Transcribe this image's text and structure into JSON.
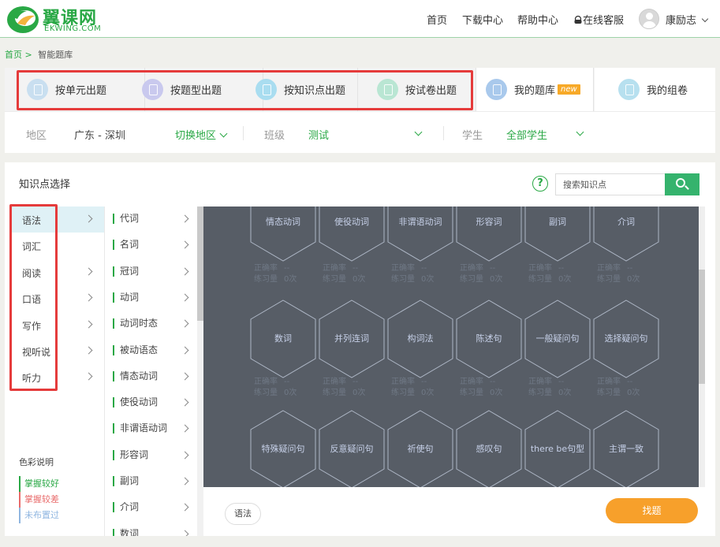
{
  "brand": {
    "name_cn": "翼课网",
    "name_en": "EKWING.COM",
    "color": "#29a845"
  },
  "nav": {
    "home": "首页",
    "download": "下载中心",
    "help": "帮助中心",
    "service": "在线客服",
    "user": "康励志"
  },
  "breadcrumb": {
    "home": "首页",
    "sep": ">",
    "current": "智能题库"
  },
  "tabs": [
    {
      "label": "按单元出题",
      "icon": "unit-icon",
      "color": "#c9dff0"
    },
    {
      "label": "按题型出题",
      "icon": "question-type-icon",
      "color": "#c9c9ee"
    },
    {
      "label": "按知识点出题",
      "icon": "knowledge-point-icon",
      "color": "#a9ddf0"
    },
    {
      "label": "按试卷出题",
      "icon": "paper-icon",
      "color": "#b9e6d3"
    },
    {
      "label": "我的题库",
      "icon": "my-bank-icon",
      "color": "#a9c9ec",
      "badge": "new"
    },
    {
      "label": "我的组卷",
      "icon": "my-paper-icon",
      "color": "#b7e0ef"
    }
  ],
  "filters": {
    "region_label": "地区",
    "region_value": "广东 - 深圳",
    "switch_region": "切换地区",
    "class_label": "班级",
    "class_value": "测试",
    "student_label": "学生",
    "student_value": "全部学生"
  },
  "panel": {
    "title": "知识点选择",
    "help": "?",
    "search_placeholder": "搜索知识点"
  },
  "categories": [
    "语法",
    "词汇",
    "阅读",
    "口语",
    "写作",
    "视听说",
    "听力"
  ],
  "subcategories": [
    "代词",
    "名词",
    "冠词",
    "动词",
    "动词时态",
    "被动语态",
    "情态动词",
    "使役动词",
    "非谓语动词",
    "形容词",
    "副词",
    "介词",
    "数词"
  ],
  "legend": {
    "title": "色彩说明",
    "items": [
      {
        "label": "掌握较好",
        "color": "#29a845"
      },
      {
        "label": "掌握较差",
        "color": "#e86a6a"
      },
      {
        "label": "未布置过",
        "color": "#8fb6e0"
      }
    ]
  },
  "stat_labels": {
    "accuracy": "正确率",
    "accuracy_value": "--",
    "practice": "练习量",
    "practice_value": "0次"
  },
  "knowledge_points": [
    [
      "情态动词",
      "使役动词",
      "非谓语动词",
      "形容词",
      "副词",
      "介词"
    ],
    [
      "数词",
      "并列连词",
      "构词法",
      "陈述句",
      "一般疑问句",
      "选择疑问句"
    ],
    [
      "特殊疑问句",
      "反意疑问句",
      "祈使句",
      "感叹句",
      "there be句型",
      "主谓一致"
    ]
  ],
  "selected": {
    "tag": "语法",
    "find_button": "找题"
  }
}
